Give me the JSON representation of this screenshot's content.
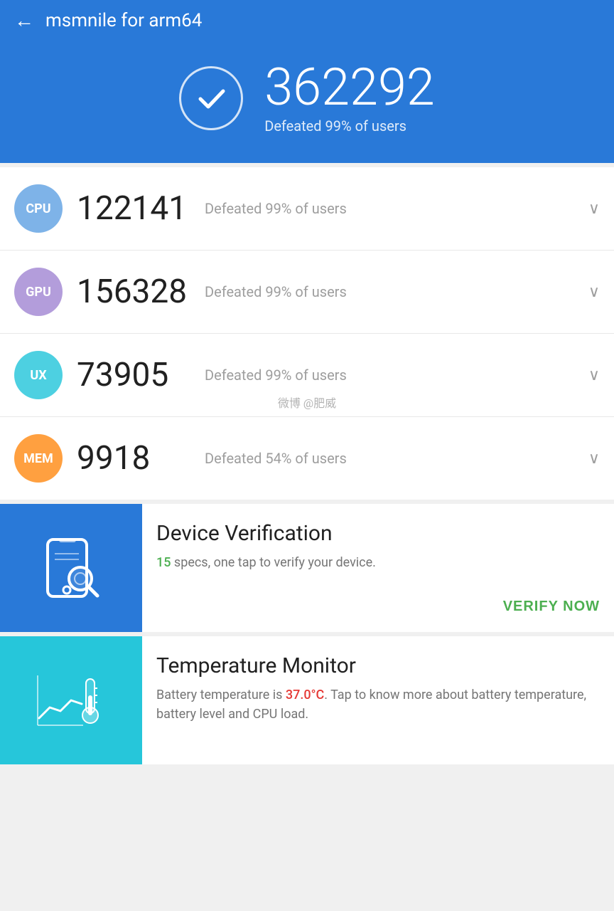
{
  "header": {
    "title": "msmnile for arm64",
    "back_label": "←"
  },
  "banner": {
    "score": "362292",
    "subtitle": "Defeated 99% of users"
  },
  "rows": [
    {
      "id": "cpu",
      "label": "CPU",
      "score": "122141",
      "defeated": "Defeated 99% of users",
      "badge_class": "badge-cpu"
    },
    {
      "id": "gpu",
      "label": "GPU",
      "score": "156328",
      "defeated": "Defeated 99% of users",
      "badge_class": "badge-gpu"
    },
    {
      "id": "ux",
      "label": "UX",
      "score": "73905",
      "defeated": "Defeated 99% of users",
      "badge_class": "badge-ux"
    },
    {
      "id": "mem",
      "label": "MEM",
      "score": "9918",
      "defeated": "Defeated 54% of users",
      "badge_class": "badge-mem"
    }
  ],
  "device_verification": {
    "title": "Device Verification",
    "specs_count": "15",
    "description_pre": " specs, one tap to verify your device.",
    "action": "VERIFY NOW"
  },
  "temperature_monitor": {
    "title": "Temperature Monitor",
    "description_pre": "Battery temperature is ",
    "temperature": "37.0°C",
    "description_post": ". Tap to know more about battery temperature, battery level and CPU load."
  },
  "watermark": "微博 @肥威"
}
